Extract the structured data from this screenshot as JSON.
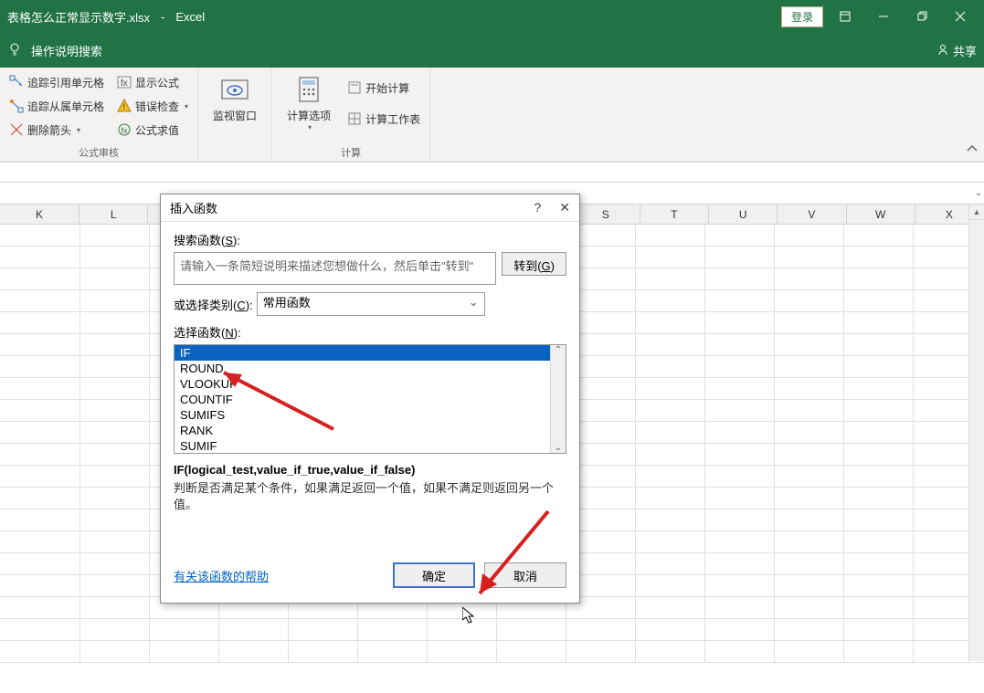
{
  "titlebar": {
    "filename": "表格怎么正常显示数字.xlsx",
    "separator": "-",
    "app": "Excel",
    "login": "登录"
  },
  "tellme": {
    "placeholder": "操作说明搜索",
    "share": "共享"
  },
  "ribbon": {
    "group1": {
      "trace_precedents": "追踪引用单元格",
      "trace_dependents": "追踪从属单元格",
      "remove_arrows": "删除箭头",
      "show_formulas": "显示公式",
      "error_checking": "错误检查",
      "evaluate_formula": "公式求值",
      "label": "公式审核"
    },
    "group2": {
      "watch_window": "监视窗口"
    },
    "group3": {
      "calc_options": "计算选项",
      "calc_now": "开始计算",
      "calc_sheet": "计算工作表",
      "label": "计算"
    }
  },
  "columns": [
    "K",
    "L",
    "",
    "",
    "",
    "",
    "",
    "S",
    "T",
    "U",
    "V",
    "W",
    "X"
  ],
  "dialog": {
    "title": "插入函数",
    "search_label_pre": "搜索函数(",
    "search_label_hot": "S",
    "search_label_post": "):",
    "search_placeholder": "请输入一条简短说明来描述您想做什么，然后单击\"转到\"",
    "go_pre": "转到(",
    "go_hot": "G",
    "go_post": ")",
    "category_label_pre": "或选择类别(",
    "category_label_hot": "C",
    "category_label_post": "):",
    "category_value": "常用函数",
    "select_label_pre": "选择函数(",
    "select_label_hot": "N",
    "select_label_post": "):",
    "functions": [
      "IF",
      "ROUND",
      "VLOOKUP",
      "COUNTIF",
      "SUMIFS",
      "RANK",
      "SUMIF"
    ],
    "signature": "IF(logical_test,value_if_true,value_if_false)",
    "description": "判断是否满足某个条件，如果满足返回一个值，如果不满足则返回另一个值。",
    "help_link": "有关该函数的帮助",
    "ok": "确定",
    "cancel": "取消"
  }
}
